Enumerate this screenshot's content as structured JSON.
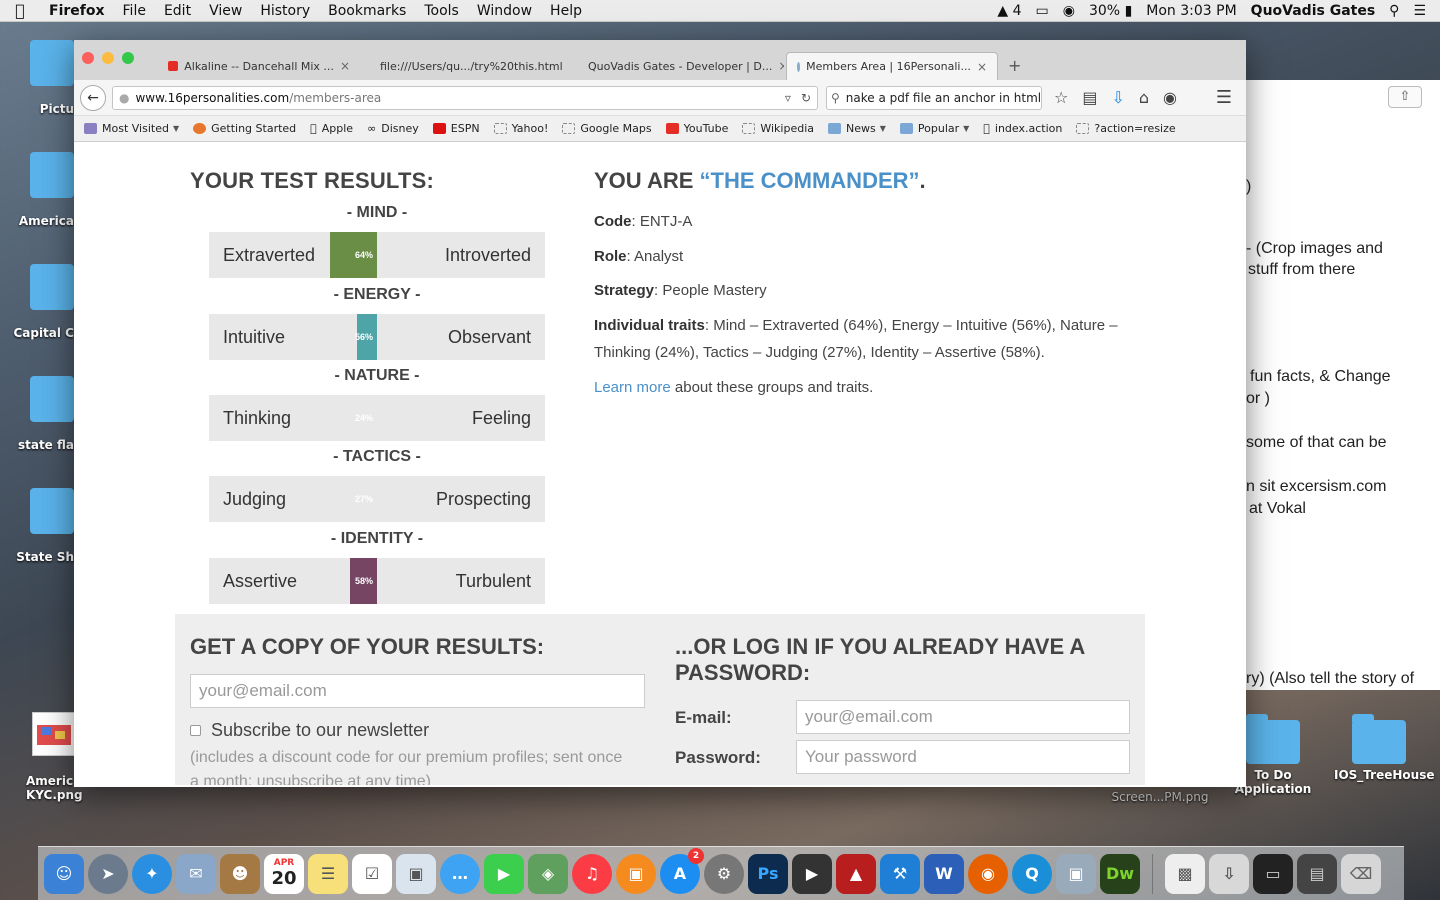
{
  "menubar": {
    "app": "Firefox",
    "items": [
      "File",
      "Edit",
      "View",
      "History",
      "Bookmarks",
      "Tools",
      "Window",
      "Help"
    ],
    "status": {
      "adobe_count": "4",
      "battery": "30%",
      "clock": "Mon 3:03 PM",
      "user": "QuoVadis Gates"
    }
  },
  "desktop": {
    "left_labels": [
      "Pictu",
      "America",
      "Capital C",
      "state fla",
      "State Sh"
    ],
    "bottom_left_file": [
      "Americ",
      "KYC.png"
    ],
    "screenshot_file": "Screen...PM.png",
    "folders": [
      {
        "label": [
          "To Do",
          "Application"
        ]
      },
      {
        "label": [
          "IOS_TreeHouse"
        ]
      }
    ]
  },
  "notes": {
    "lines": [
      ")",
      "- (Crop images and",
      "stuff from there",
      "fun facts, & Change",
      "or )",
      "some of that can be",
      "n sit excersism.com",
      "at Vokal",
      "ry) (Also tell the story of"
    ]
  },
  "browser": {
    "tabs": [
      {
        "title": "Alkaline -- Dancehall Mix ...",
        "close": "×"
      },
      {
        "title": "file:///Users/qu.../try%20this.html",
        "close": "×"
      },
      {
        "title": "QuoVadis Gates - Developer | D...",
        "close": "×"
      },
      {
        "title": "Members Area | 16Personali...",
        "close": "×"
      }
    ],
    "new_tab": "+",
    "url_host": "www.16personalities.com",
    "url_path": "/members-area",
    "search_value": "nake a pdf file an anchor in html",
    "bookmarks": [
      {
        "label": "Most Visited",
        "caret": true
      },
      {
        "label": "Getting Started"
      },
      {
        "label": "Apple"
      },
      {
        "label": "Disney"
      },
      {
        "label": "ESPN"
      },
      {
        "label": "Yahoo!"
      },
      {
        "label": "Google Maps"
      },
      {
        "label": "YouTube"
      },
      {
        "label": "Wikipedia"
      },
      {
        "label": "News",
        "caret": true
      },
      {
        "label": "Popular",
        "caret": true
      },
      {
        "label": "index.action"
      },
      {
        "label": "?action=resize"
      }
    ]
  },
  "results": {
    "title": "YOUR TEST RESULTS:",
    "traits": [
      {
        "head": "- MIND -",
        "left": "Extraverted",
        "right": "Introverted",
        "pct": "64%",
        "value": 0.64,
        "side": "left",
        "color": "#6b8e47"
      },
      {
        "head": "- ENERGY -",
        "left": "Intuitive",
        "right": "Observant",
        "pct": "56%",
        "value": 0.56,
        "side": "left",
        "color": "#4fa4a8"
      },
      {
        "head": "- NATURE -",
        "left": "Thinking",
        "right": "Feeling",
        "pct": "24%",
        "value": 0.24,
        "side": "left",
        "color": "#e34446"
      },
      {
        "head": "- TACTICS -",
        "left": "Judging",
        "right": "Prospecting",
        "pct": "27%",
        "value": 0.27,
        "side": "left",
        "color": "#e1c02e"
      },
      {
        "head": "- IDENTITY -",
        "left": "Assertive",
        "right": "Turbulent",
        "pct": "58%",
        "value": 0.58,
        "side": "left",
        "color": "#754563"
      }
    ]
  },
  "profile": {
    "you_are_prefix": "YOU ARE ",
    "type_name": "“THE COMMANDER”",
    "you_are_suffix": ".",
    "code_label": "Code",
    "code_value": ": ENTJ-A",
    "role_label": "Role",
    "role_value": ": Analyst",
    "strategy_label": "Strategy",
    "strategy_value": ": People Mastery",
    "traits_label": "Individual traits",
    "traits_value": ": Mind – Extraverted (64%), Energy – Intuitive (56%), Nature – Thinking (24%), Tactics – Judging (27%), Identity – Assertive (58%).",
    "learn_more": "Learn more",
    "learn_more_rest": " about these groups and traits."
  },
  "copy": {
    "title": "GET A COPY OF YOUR RESULTS:",
    "email_placeholder": "your@email.com",
    "subscribe_label": "Subscribe to our newsletter",
    "subscribe_note": "(includes a discount code for our premium profiles; sent once a month; unsubscribe at any time)"
  },
  "login": {
    "title": "...OR LOG IN IF YOU ALREADY HAVE A PASSWORD:",
    "email_label": "E-mail:",
    "email_placeholder": "your@email.com",
    "password_label": "Password:",
    "password_placeholder": "Your password"
  },
  "dock": {
    "calendar_month": "APR",
    "calendar_day": "20",
    "appstore_badge": "2",
    "ps_label": "Ps",
    "w_label": "W",
    "dw_label": "Dw"
  }
}
